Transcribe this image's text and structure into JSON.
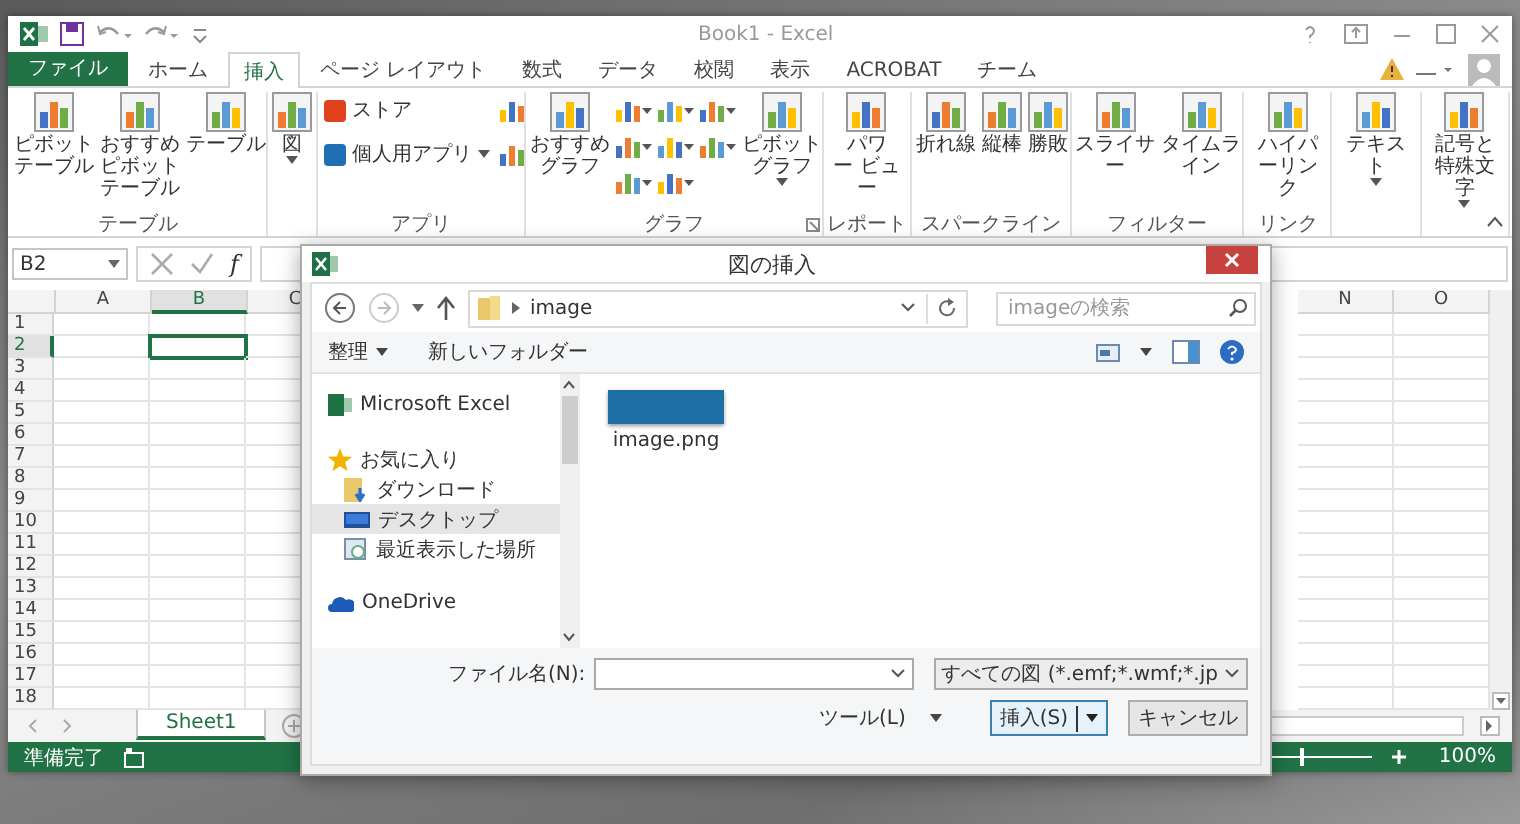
{
  "excel": {
    "title": "Book1 - Excel",
    "ribbon_tabs": [
      {
        "label": "ファイル",
        "kind": "file",
        "selected": false
      },
      {
        "label": "ホーム",
        "kind": "tab",
        "selected": false
      },
      {
        "label": "挿入",
        "kind": "tab",
        "selected": true
      },
      {
        "label": "ページ レイアウト",
        "kind": "tab",
        "selected": false
      },
      {
        "label": "数式",
        "kind": "tab",
        "selected": false
      },
      {
        "label": "データ",
        "kind": "tab",
        "selected": false
      },
      {
        "label": "校閲",
        "kind": "tab",
        "selected": false
      },
      {
        "label": "表示",
        "kind": "tab",
        "selected": false
      },
      {
        "label": "ACROBAT",
        "kind": "tab",
        "selected": false
      },
      {
        "label": "チーム",
        "kind": "tab",
        "selected": false
      }
    ],
    "ribbon_groups": [
      {
        "label": "テーブル",
        "launcher": false,
        "commands": [
          {
            "kind": "large",
            "label": "ピボットテーブル",
            "has_menu": false
          },
          {
            "kind": "large",
            "label": "おすすめピボットテーブル",
            "has_menu": false
          },
          {
            "kind": "large",
            "label": "テーブル",
            "has_menu": false
          }
        ]
      },
      {
        "launcher": false,
        "commands": [
          {
            "kind": "large",
            "label": "図",
            "has_menu": true
          }
        ]
      },
      {
        "label": "アプリ",
        "launcher": false,
        "commands": [
          {
            "kind": "small",
            "label": "ストア",
            "has_menu": false
          },
          {
            "kind": "small",
            "label": "個人用アプリ",
            "has_menu": true
          },
          {
            "kind": "icon",
            "has_menu": false
          },
          {
            "kind": "icon",
            "has_menu": false
          }
        ]
      },
      {
        "label": "グラフ",
        "launcher": true,
        "commands": [
          {
            "kind": "large",
            "label": "おすすめグラフ",
            "has_menu": false
          },
          {
            "kind": "icon",
            "has_menu": true
          },
          {
            "kind": "icon",
            "has_menu": true
          },
          {
            "kind": "icon",
            "has_menu": true
          },
          {
            "kind": "icon",
            "has_menu": true
          },
          {
            "kind": "icon",
            "has_menu": true
          },
          {
            "kind": "icon",
            "has_menu": true
          },
          {
            "kind": "icon",
            "has_menu": true
          },
          {
            "kind": "icon",
            "has_menu": true
          },
          {
            "kind": "large",
            "label": "ピボットグラフ",
            "has_menu": true
          }
        ]
      },
      {
        "label": "レポート",
        "launcher": false,
        "commands": [
          {
            "kind": "large",
            "label": "パワー ビュー",
            "has_menu": false
          }
        ]
      },
      {
        "label": "スパークライン",
        "launcher": false,
        "commands": [
          {
            "kind": "large",
            "label": "折れ線",
            "has_menu": false
          },
          {
            "kind": "large",
            "label": "縦棒",
            "has_menu": false
          },
          {
            "kind": "large",
            "label": "勝敗",
            "has_menu": false
          }
        ]
      },
      {
        "label": "フィルター",
        "launcher": false,
        "commands": [
          {
            "kind": "large",
            "label": "スライサー",
            "has_menu": false
          },
          {
            "kind": "large",
            "label": "タイムライン",
            "has_menu": false
          }
        ]
      },
      {
        "label": "リンク",
        "launcher": false,
        "commands": [
          {
            "kind": "large",
            "label": "ハイパーリンク",
            "has_menu": false
          }
        ]
      },
      {
        "launcher": false,
        "commands": [
          {
            "kind": "large",
            "label": "テキスト",
            "has_menu": true
          }
        ]
      },
      {
        "launcher": false,
        "commands": [
          {
            "kind": "large",
            "label": "記号と特殊文字",
            "has_menu": true
          }
        ]
      }
    ],
    "name_box": "B2",
    "fx_label": "f",
    "columns": [
      {
        "label": "A",
        "selected": false
      },
      {
        "label": "B",
        "selected": true
      },
      {
        "label": "C",
        "selected": false
      },
      {
        "label": "N",
        "selected": false
      },
      {
        "label": "O",
        "selected": false
      }
    ],
    "rows": [
      {
        "label": "1",
        "selected": false
      },
      {
        "label": "2",
        "selected": true
      },
      {
        "label": "3",
        "selected": false
      },
      {
        "label": "4",
        "selected": false
      },
      {
        "label": "5",
        "selected": false
      },
      {
        "label": "6",
        "selected": false
      },
      {
        "label": "7",
        "selected": false
      },
      {
        "label": "8",
        "selected": false
      },
      {
        "label": "9",
        "selected": false
      },
      {
        "label": "10",
        "selected": false
      },
      {
        "label": "11",
        "selected": false
      },
      {
        "label": "12",
        "selected": false
      },
      {
        "label": "13",
        "selected": false
      },
      {
        "label": "14",
        "selected": false
      },
      {
        "label": "15",
        "selected": false
      },
      {
        "label": "16",
        "selected": false
      },
      {
        "label": "17",
        "selected": false
      },
      {
        "label": "18",
        "selected": false
      }
    ],
    "sheets": [
      {
        "label": "Sheet1",
        "selected": true
      }
    ],
    "status_bar": {
      "status": "準備完了",
      "zoom": "100%",
      "zoom_slider": {
        "level": 0.5
      }
    }
  },
  "dialog": {
    "title": "図の挿入",
    "path": "image",
    "search": {
      "placeholder": "imageの検索"
    },
    "toolbar": {
      "organize": "整理",
      "new_folder": "新しいフォルダー"
    },
    "nav": [
      {
        "label": "Microsoft Excel",
        "kind": "excel",
        "selected": false
      },
      {
        "label": "お気に入り",
        "kind": "star",
        "selected": false,
        "children": [
          {
            "label": "ダウンロード",
            "kind": "download",
            "selected": false
          },
          {
            "label": "デスクトップ",
            "kind": "desktop",
            "selected": true
          },
          {
            "label": "最近表示した場所",
            "kind": "recent",
            "selected": false
          }
        ]
      },
      {
        "label": "OneDrive",
        "kind": "cloud",
        "selected": false
      }
    ],
    "files": [
      {
        "name": "image.png"
      }
    ],
    "file_name_label": "ファイル名(N):",
    "file_type": "すべての図 (*.emf;*.wmf;*.jp",
    "tools": "ツール(L)",
    "insert": "挿入(S)",
    "cancel": "キャンセル"
  }
}
